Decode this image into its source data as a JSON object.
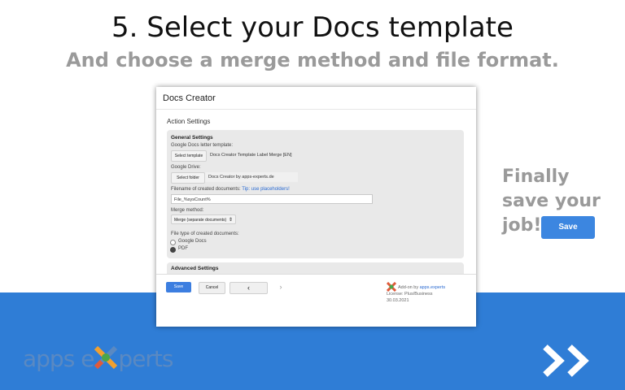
{
  "title": "5. Select your Docs template",
  "subtitle": "And choose a merge method and file format.",
  "dialog": {
    "app_title": "Docs Creator",
    "section_title": "Action Settings",
    "general_settings": {
      "heading": "General Settings",
      "template_label": "Google Docs letter template:",
      "select_template_button": "Select template",
      "template_value": "Docs Creator Template Label Merge [EN]",
      "drive_label": "Google Drive:",
      "select_folder_button": "Select folder",
      "folder_value": "Docs Creator by apps-experts.de",
      "filename_label": "Filename of created documents:",
      "filename_tip": "Tip: use placeholders!",
      "filename_value": "File_%sysCount%",
      "merge_label": "Merge method:",
      "merge_value": "Merge (separate documents)",
      "filetype_label": "File type of created documents:",
      "filetype_options": [
        "Google Docs",
        "PDF"
      ],
      "filetype_selected": "PDF"
    },
    "advanced_settings": {
      "heading": "Advanced Settings"
    },
    "footer": {
      "save": "Save",
      "cancel": "Cancel",
      "prev": "‹",
      "next": "›",
      "addon_prefix": "Add-on by",
      "addon_link": "apps.experts",
      "license": "License: Plus/Business",
      "license_date": "30.03.2021"
    }
  },
  "side": {
    "finally_lines": [
      "Finally",
      "save your",
      "job!"
    ],
    "save_button": "Save"
  },
  "branding": {
    "logo_text_left": "apps e",
    "logo_text_right": "perts",
    "logo_icon": "x-logo-icon",
    "next_icon": "double-chevron-right-icon"
  },
  "colors": {
    "band": "#2f7dd6",
    "accent_button": "#3c86e0",
    "subtitle_gray": "#9a9a9a",
    "panel_gray": "#e9e9e9"
  }
}
